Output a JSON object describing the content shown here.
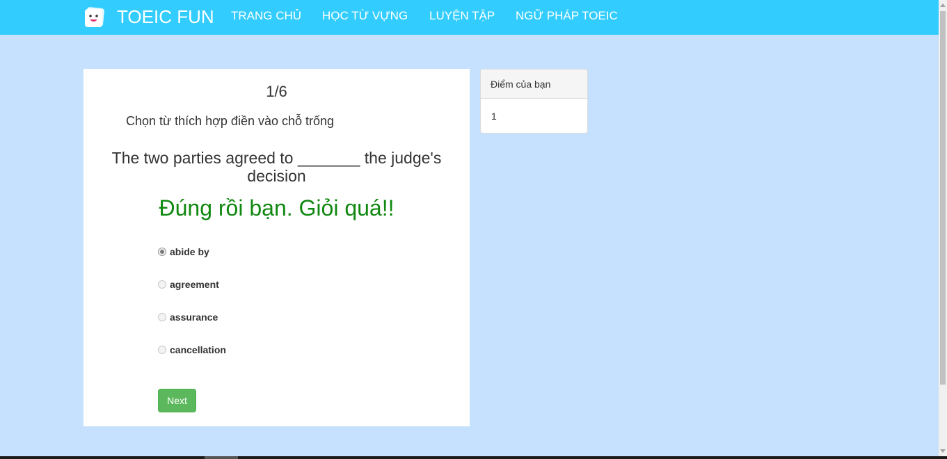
{
  "navbar": {
    "brand": "TOEIC FUN",
    "items": [
      {
        "label": "TRANG CHỦ"
      },
      {
        "label": "HỌC TỪ VỰNG"
      },
      {
        "label": "LUYỆN TẬP"
      },
      {
        "label": "NGỮ PHÁP TOEIC"
      }
    ],
    "background": "#32cdfe"
  },
  "quiz": {
    "counter": "1/6",
    "instruction": "Chọn từ thích hợp điền vào chỗ trống",
    "question": "The two parties agreed to _______ the judge's decision",
    "feedback": "Đúng rồi bạn. Giỏi quá!!",
    "feedback_color": "#108810",
    "options": [
      {
        "label": "abide by",
        "selected": true
      },
      {
        "label": "agreement",
        "selected": false
      },
      {
        "label": "assurance",
        "selected": false
      },
      {
        "label": "cancellation",
        "selected": false
      }
    ],
    "next_label": "Next"
  },
  "score": {
    "heading": "Điểm của bạn",
    "value": "1"
  },
  "page_background": "#c5e1fd"
}
